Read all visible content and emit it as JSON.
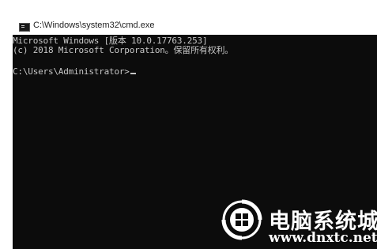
{
  "window": {
    "title": "C:\\Windows\\system32\\cmd.exe",
    "icon": "cmd-app-icon"
  },
  "console": {
    "lines": [
      "Microsoft Windows [版本 10.0.17763.253]",
      "(c) 2018 Microsoft Corporation。保留所有权利。",
      "C:\\Users\\Administrator>"
    ],
    "background": "#0c0c0c",
    "text_color": "#c7c7c7"
  },
  "watermark": {
    "name": "电脑系统城",
    "url": "www.dnxtc.net",
    "logo": "watermark-logo-icon"
  }
}
